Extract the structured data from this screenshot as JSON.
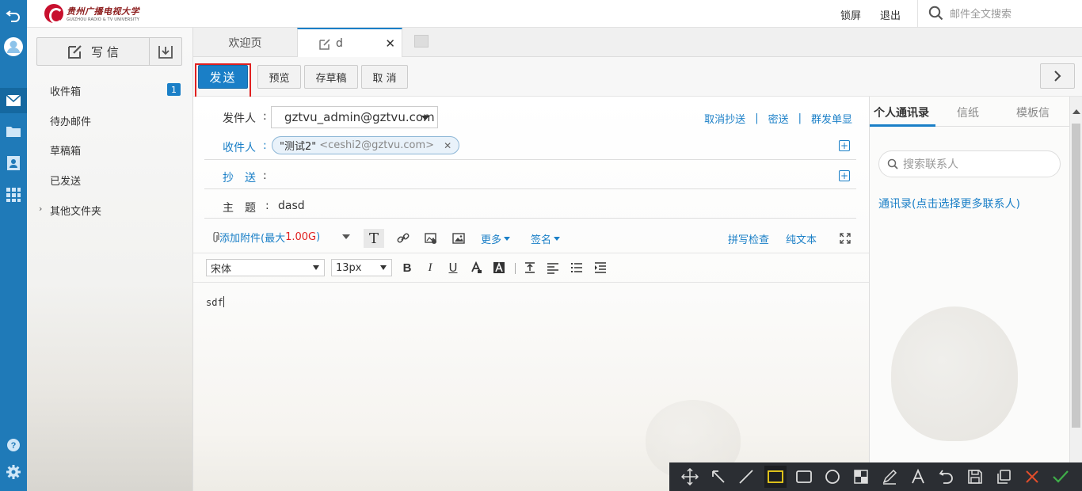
{
  "header": {
    "logo_cn": "贵州广播电视大学",
    "logo_en": "GUIZHOU RADIO & TV UNIVERSITY",
    "lock_label": "锁屏",
    "logout_label": "退出",
    "search_placeholder": "邮件全文搜索"
  },
  "rail": {
    "icons": [
      "back-icon",
      "avatar-icon",
      "mail-icon",
      "folder-icon",
      "contacts-icon",
      "apps-icon",
      "help-icon",
      "settings-icon"
    ],
    "active": "mail-icon",
    "color": "#1f7ab8"
  },
  "nav": {
    "compose_label": "写 信",
    "items": [
      {
        "label": "收件箱",
        "badge": "1"
      },
      {
        "label": "待办邮件"
      },
      {
        "label": "草稿箱"
      },
      {
        "label": "已发送"
      },
      {
        "label": "其他文件夹"
      }
    ]
  },
  "tabs": {
    "welcome": "欢迎页",
    "current": "d"
  },
  "toolbar": {
    "send": "发送",
    "preview": "预览",
    "save_draft": "存草稿",
    "cancel": "取 消"
  },
  "compose": {
    "sender_label": "发件人",
    "sender_value": "gztvu_admin@gztvu.com",
    "links": [
      "取消抄送",
      "密送",
      "群发单显"
    ],
    "to_label": "收件人",
    "recipient_name": "\"测试2\"",
    "recipient_email": "<ceshi2@gztvu.com>",
    "cc_label": "抄　送",
    "subject_label": "主　题",
    "subject_value": "dasd",
    "attach_label": "添加附件(最大",
    "attach_size": "1.00G",
    "attach_close": ")",
    "more_label": "更多",
    "signature_label": "签名",
    "spell_label": "拼写检查",
    "plain_label": "纯文本",
    "font_family": "宋体",
    "font_size": "13px",
    "body_text": "sdf"
  },
  "contacts": {
    "tabs": [
      "个人通讯录",
      "信纸",
      "模板信"
    ],
    "active_tab": "个人通讯录",
    "search_placeholder": "搜索联系人",
    "address_link": "通讯录(点击选择更多联系人)"
  },
  "snapbar": {
    "tools": [
      "move-icon",
      "arrow-icon",
      "line-icon",
      "rect-highlight-icon",
      "rect-icon",
      "ellipse-icon",
      "mosaic-icon",
      "pen-icon",
      "text-icon",
      "undo-icon",
      "save-icon",
      "copy-icon",
      "close-icon",
      "confirm-icon"
    ],
    "active": "rect-highlight-icon",
    "highlight_color": "#f2d21b"
  },
  "colors": {
    "accent": "#1a7fc7",
    "red": "#e02020"
  }
}
